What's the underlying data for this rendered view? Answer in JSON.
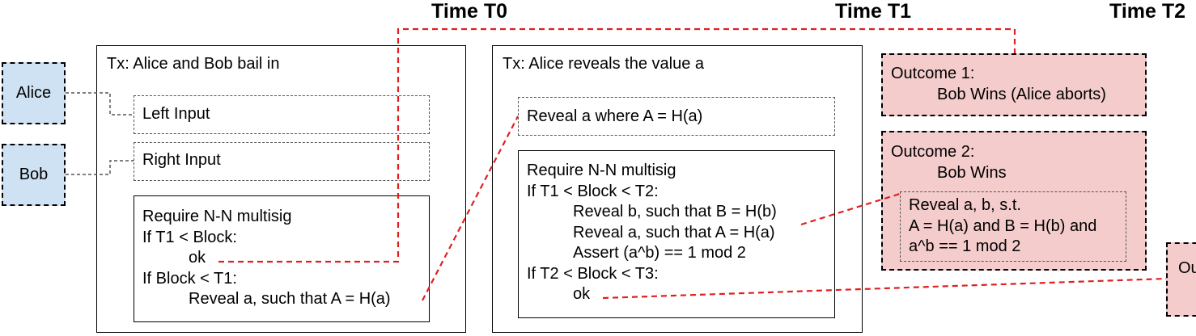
{
  "times": {
    "t0": "Time T0",
    "t1": "Time T1",
    "t2": "Time T2"
  },
  "parties": {
    "alice": "Alice",
    "bob": "Bob"
  },
  "tx1": {
    "title": "Tx: Alice and Bob bail in",
    "left_input": "Left Input",
    "right_input": "Right Input",
    "script": [
      "Require N-N multisig",
      "If T1 < Block:",
      "ok",
      "If Block < T1:",
      "Reveal a, such that A = H(a)"
    ]
  },
  "tx2": {
    "title": "Tx: Alice reveals the value a",
    "input": "Reveal a where  A = H(a)",
    "script": [
      "Require N-N multisig",
      "If T1 < Block < T2:",
      "Reveal b, such that B = H(b)",
      "Reveal a, such that A = H(a)",
      "Assert (a^b) == 1 mod 2",
      "If T2 < Block < T3:",
      "ok"
    ]
  },
  "outcomes": {
    "o1_title": "Outcome 1:",
    "o1_detail": "Bob Wins (Alice aborts)",
    "o2_title": "Outcome 2:",
    "o2_detail": "Bob Wins",
    "o2_reveal": [
      "Reveal a, b, s.t.",
      "A = H(a) and B = H(b) and",
      "a^b == 1 mod 2"
    ],
    "o3_partial": "Ou"
  },
  "colors": {
    "party_fill": "#cfe2f3",
    "outcome_fill": "#f4cccc",
    "link_red": "#e02020"
  }
}
